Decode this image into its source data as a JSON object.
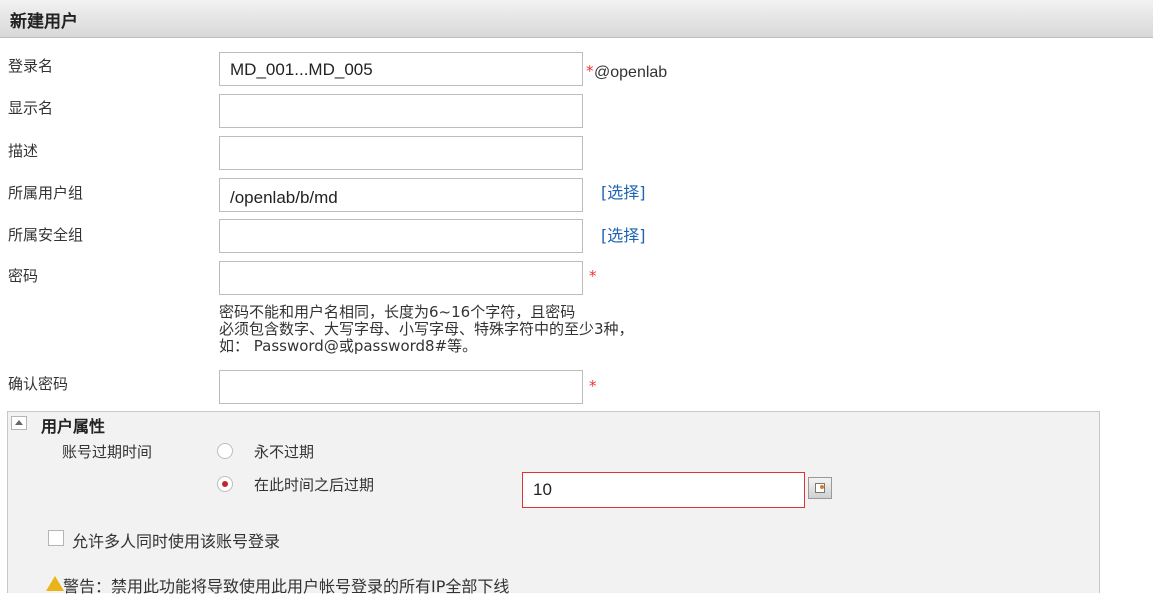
{
  "header": {
    "title": "新建用户"
  },
  "form": {
    "login": {
      "label": "登录名",
      "value": "MD_001...MD_005",
      "required": "*",
      "suffix": "@openlab"
    },
    "display": {
      "label": "显示名",
      "value": ""
    },
    "desc": {
      "label": "描述",
      "value": ""
    },
    "group": {
      "label": "所属用户组",
      "value": "/openlab/b/md",
      "link": "[选择]"
    },
    "secgroup": {
      "label": "所属安全组",
      "value": "",
      "link": "[选择]"
    },
    "password": {
      "label": "密码",
      "value": "",
      "required": "*"
    },
    "hint": [
      "密码不能和用户名相同，长度为6~16个字符，且密码",
      "必须包含数字、大写字母、小写字母、特殊字符中的至少3种，",
      "如： Password@或password8#等。"
    ],
    "confirm": {
      "label": "确认密码",
      "value": "",
      "required": "*"
    }
  },
  "attrs": {
    "title": "用户属性",
    "expire_label": "账号过期时间",
    "options": [
      {
        "label": "永不过期",
        "selected": false
      },
      {
        "label": "在此时间之后过期",
        "selected": true
      }
    ],
    "expire_value": "10",
    "multi_login": {
      "label": "允许多人同时使用该账号登录",
      "checked": false
    },
    "warning": "警告：禁用此功能将导致使用此用户帐号登录的所有IP全部下线"
  },
  "colors": {
    "required": "#e33333",
    "link": "#1f63b5",
    "radio_selected": "#c0272d",
    "error_border": "#dd3333"
  }
}
